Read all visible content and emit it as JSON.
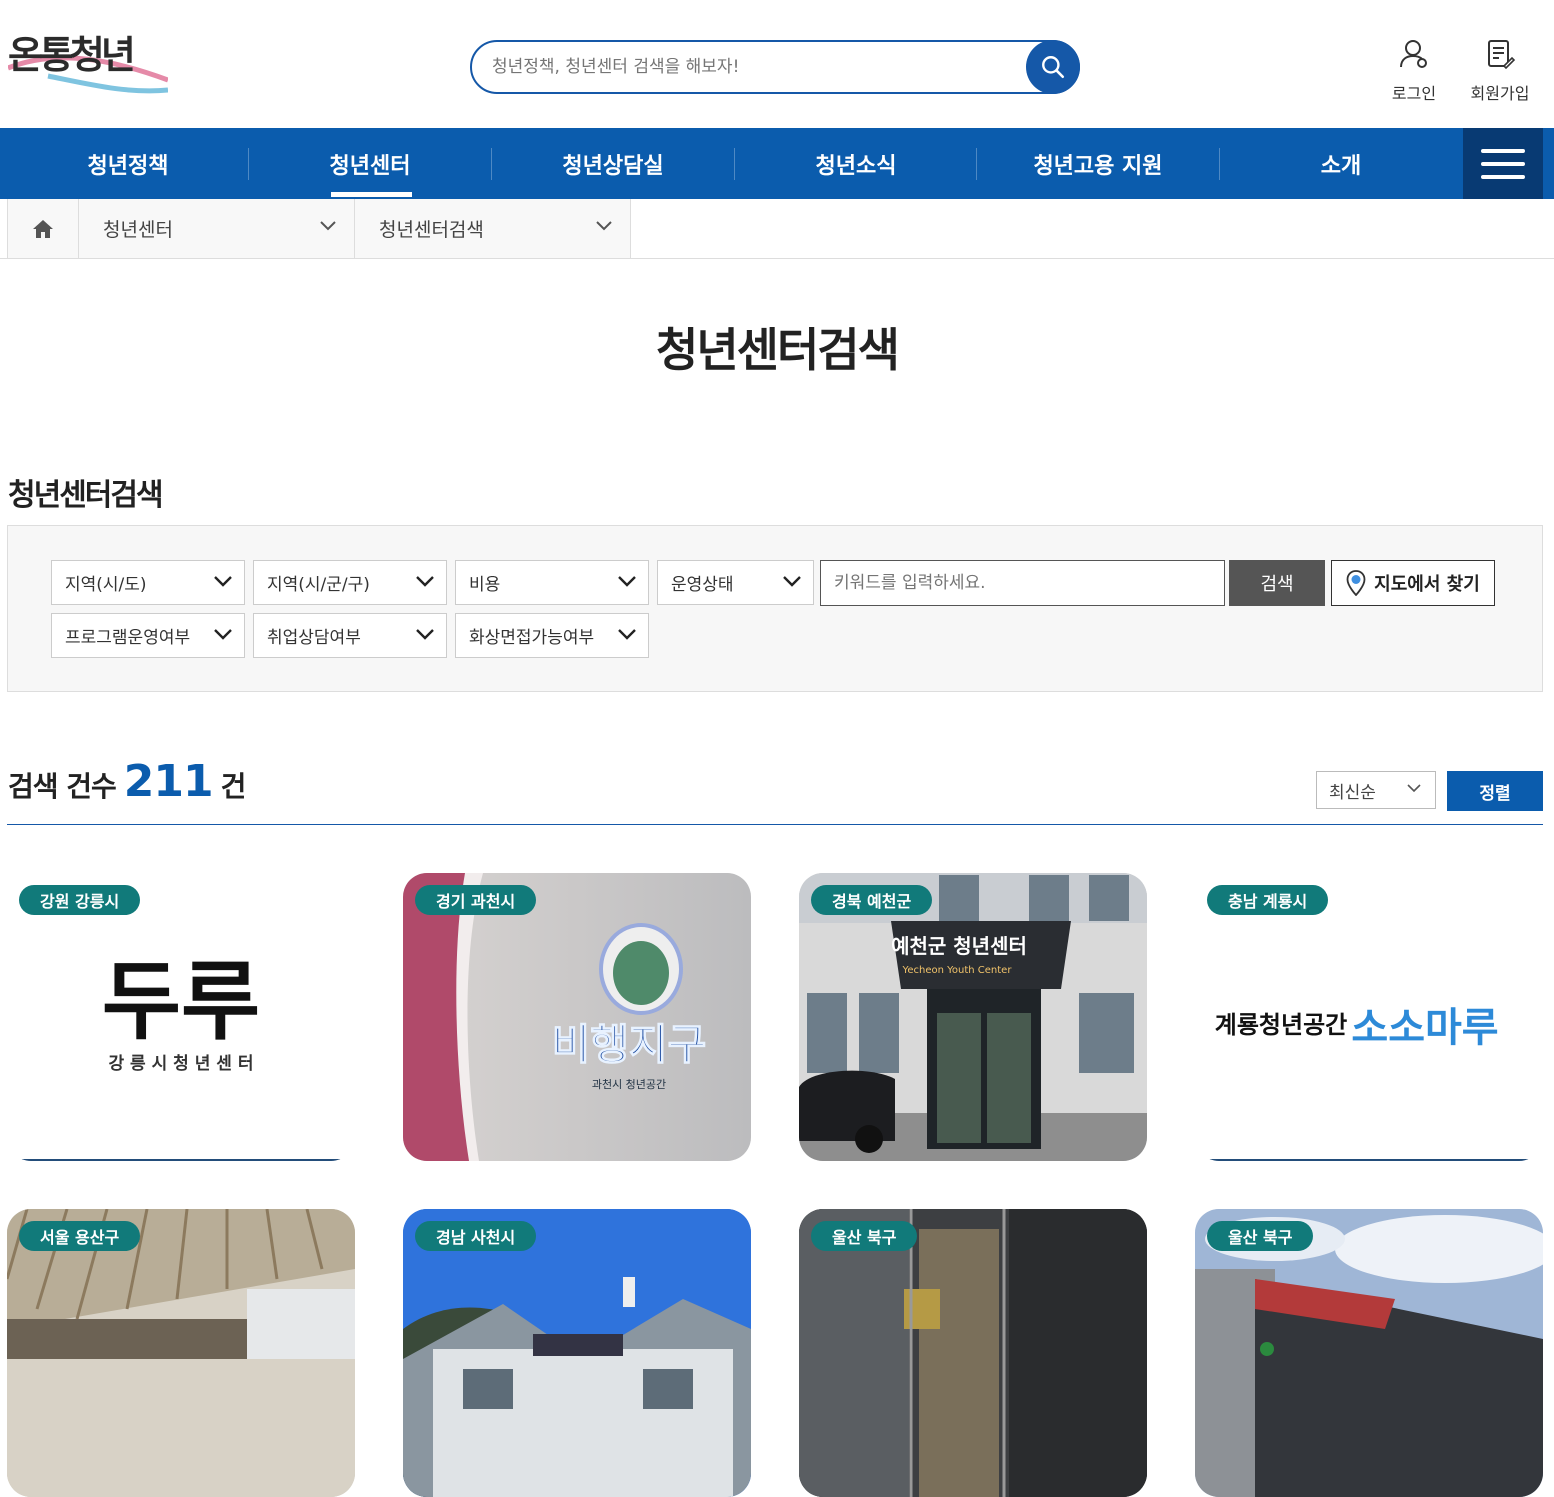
{
  "header": {
    "search_placeholder": "청년정책, 청년센터 검색을 해보자!",
    "login_label": "로그인",
    "signup_label": "회원가입"
  },
  "nav": {
    "items": [
      "청년정책",
      "청년센터",
      "청년상담실",
      "청년소식",
      "청년고용 지원",
      "소개"
    ],
    "active": "청년센터"
  },
  "breadcrumb": {
    "level1": "청년센터",
    "level2": "청년센터검색"
  },
  "page_title": "청년센터검색",
  "section_title": "청년센터검색",
  "filters": {
    "row1": [
      "지역(시/도)",
      "지역(시/군/구)",
      "비용",
      "운영상태"
    ],
    "row2": [
      "프로그램운영여부",
      "취업상담여부",
      "화상면접가능여부"
    ],
    "keyword_placeholder": "키워드를 입력하세요.",
    "search_button": "검색",
    "map_button": "지도에서 찾기"
  },
  "results": {
    "count_prefix": "검색 건수",
    "count": "211",
    "count_suffix": "건",
    "sort_value": "최신순",
    "sort_button": "정렬"
  },
  "cards": [
    {
      "region": "강원 강릉시",
      "logo_main": "두루",
      "logo_sub": "강 릉 시  청 년 센 터"
    },
    {
      "region": "경기 과천시",
      "sign_text": "비행지구",
      "sign_sub": "과천시 청년공간"
    },
    {
      "region": "경북 예천군",
      "sign_text": "예천군 청년센터",
      "sign_sub": "Yecheon Youth Center"
    },
    {
      "region": "충남 계룡시",
      "logo_main": "계룡청년공간",
      "logo_accent": "소소마루"
    },
    {
      "region": "서울 용산구"
    },
    {
      "region": "경남 사천시"
    },
    {
      "region": "울산 북구"
    },
    {
      "region": "울산 북구"
    }
  ],
  "colors": {
    "primary": "#0b5cad",
    "badge": "#117a7a",
    "nav_menu": "#083a73"
  }
}
